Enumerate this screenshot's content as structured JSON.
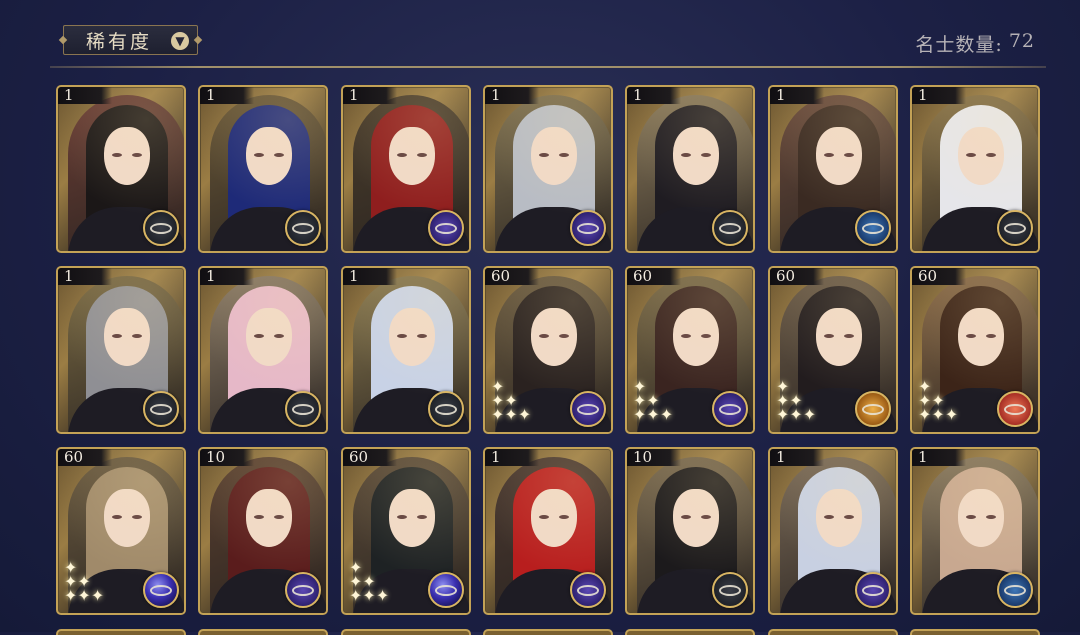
{
  "header": {
    "sort_label": "稀有度",
    "sort_icon": "chevron-down-icon",
    "count_label": "名士数量:",
    "count_value": "72"
  },
  "colors": {
    "card_border": "#c3a256",
    "background": "#1c2045",
    "badge_grey": "#2a2d35",
    "badge_purple": "#3a2a8a",
    "badge_blue": "#1f4a85",
    "badge_gold": "#c7862a",
    "badge_red": "#c8422f"
  },
  "cards": [
    {
      "level": "1",
      "badge": "grey",
      "hair": "#1b1717",
      "bg": "#6b3d35",
      "sparkles": false
    },
    {
      "level": "1",
      "badge": "grey",
      "hair": "#1e2a78",
      "bg": "#6a5838",
      "sparkles": false
    },
    {
      "level": "1",
      "badge": "purple",
      "hair": "#8f1e1e",
      "bg": "#4a3d2c",
      "sparkles": false
    },
    {
      "level": "1",
      "badge": "purple",
      "hair": "#b8bcc4",
      "bg": "#807251",
      "sparkles": false
    },
    {
      "level": "1",
      "badge": "grey",
      "hair": "#1f1c22",
      "bg": "#8a7a5c",
      "sparkles": false
    },
    {
      "level": "1",
      "badge": "blue",
      "hair": "#3a2a22",
      "bg": "#6a4a3c",
      "sparkles": false
    },
    {
      "level": "1",
      "badge": "grey",
      "hair": "#e6e6ea",
      "bg": "#8a7448",
      "sparkles": false
    },
    {
      "level": "1",
      "badge": "grey",
      "hair": "#8f8f94",
      "bg": "#7a6a44",
      "sparkles": false
    },
    {
      "level": "1",
      "badge": "grey",
      "hair": "#e6b8c8",
      "bg": "#8a7a66",
      "sparkles": false
    },
    {
      "level": "1",
      "badge": "grey",
      "hair": "#c8d2e6",
      "bg": "#8a7a50",
      "sparkles": false
    },
    {
      "level": "60",
      "badge": "purple",
      "hair": "#2a2220",
      "bg": "#6a5a40",
      "sparkles": true
    },
    {
      "level": "60",
      "badge": "purple",
      "hair": "#3a2420",
      "bg": "#7a6a48",
      "sparkles": true
    },
    {
      "level": "60",
      "badge": "gold",
      "hair": "#221c1e",
      "bg": "#6a5a48",
      "sparkles": true
    },
    {
      "level": "60",
      "badge": "red",
      "hair": "#3c2418",
      "bg": "#8a6a48",
      "sparkles": true
    },
    {
      "level": "60",
      "badge": "orb",
      "hair": "#a08a6a",
      "bg": "#6a5a40",
      "sparkles": true
    },
    {
      "level": "10",
      "badge": "purple",
      "hair": "#5a1c1c",
      "bg": "#5a4030",
      "sparkles": false
    },
    {
      "level": "60",
      "badge": "orb",
      "hair": "#1e2224",
      "bg": "#5a4a38",
      "sparkles": true
    },
    {
      "level": "1",
      "badge": "purple",
      "hair": "#b81e1e",
      "bg": "#4a3830",
      "sparkles": false
    },
    {
      "level": "10",
      "badge": "grey",
      "hair": "#1c1a1c",
      "bg": "#7a6a50",
      "sparkles": false
    },
    {
      "level": "1",
      "badge": "purple",
      "hair": "#c8d0e2",
      "bg": "#7a6a58",
      "sparkles": false
    },
    {
      "level": "1",
      "badge": "blue",
      "hair": "#c8a890",
      "bg": "#8a7a60",
      "sparkles": false
    }
  ]
}
